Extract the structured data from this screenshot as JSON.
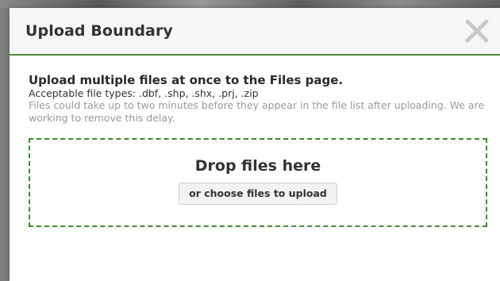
{
  "modal": {
    "title": "Upload Boundary",
    "close_icon": "close-icon"
  },
  "body": {
    "heading": "Upload multiple files at once to the Files page.",
    "file_types": "Acceptable file types: .dbf, .shp, .shx, .prj, .zip",
    "delay_note": "Files could take up to two minutes before they appear in the file list after uploading. We are working to remove this delay."
  },
  "dropzone": {
    "label": "Drop files here",
    "button_label": "or choose files to upload"
  },
  "colors": {
    "accent_green": "#4a8a3c",
    "dropzone_border": "#3f8a2f",
    "title_text": "#333333",
    "muted_text": "#9a9a9a"
  }
}
